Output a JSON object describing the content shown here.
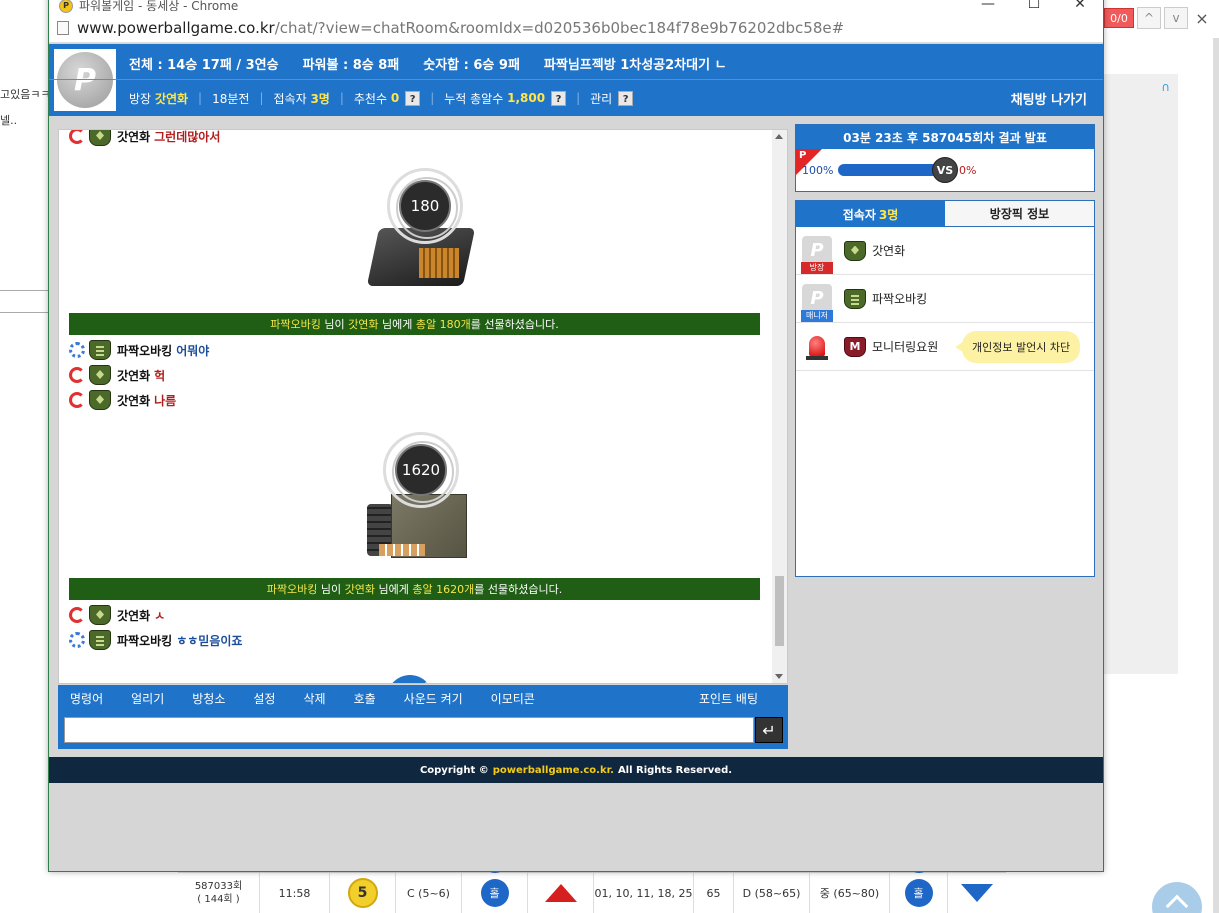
{
  "background": {
    "left_texts": [
      "고있음ㅋㅋ",
      "넬.."
    ],
    "find": {
      "count": "0/0",
      "up": "^",
      "down": "v",
      "close": "×"
    },
    "row": {
      "round": "587033회",
      "round_sub": "( 144회 )",
      "time": "11:58",
      "ball": "5",
      "range": "C (5~6)",
      "oddeven": "홀",
      "numbers": "01, 10, 11, 18, 25",
      "sum": "65",
      "sum_range": "D (58~65)",
      "size": "중 (65~80)",
      "oddeven2": "홀"
    }
  },
  "window": {
    "title": "파워볼게임 - 동세상 - Chrome",
    "url_host": "www.powerballgame.co.kr",
    "url_path": "/chat/?view=chatRoom&roomIdx=d020536b0bec184f78e9b76202dbc58e#",
    "controls": {
      "minimize": "—",
      "maximize": "☐",
      "close": "✕"
    }
  },
  "header": {
    "logo_letter": "P",
    "stats": {
      "total": "전체 : 14승 17패 / 3연승",
      "powerball": "파워볼 : 8승 8패",
      "numbersum": "숫자합 : 6승 9패",
      "room_name": "파짝님프젝방 1차성공2차대기 ㄴ"
    },
    "sub": {
      "owner_label": "방장",
      "owner_name": "갓연화",
      "rank": "18분전",
      "users_label": "접속자",
      "users_value": "3명",
      "recommend_label": "추천수",
      "recommend_value": "0",
      "total_label": "누적 총알수",
      "total_value": "1,800",
      "manage_label": "관리",
      "help": "?",
      "exit": "채팅방 나가기"
    }
  },
  "chat": {
    "messages": [
      {
        "nick": "갓연화",
        "text": "그런데많아서"
      },
      {
        "nick": "파짝오바킹",
        "text": "어뭐야"
      },
      {
        "nick": "갓연화",
        "text": "헉"
      },
      {
        "nick": "갓연화",
        "text": "나름"
      },
      {
        "nick": "갓연화",
        "text": "ㅅ"
      },
      {
        "nick": "파짝오바킹",
        "text": "ㅎㅎ믿음이죠"
      }
    ],
    "gifts": [
      {
        "amount": "180",
        "notice": {
          "sender": "파짝오바킹",
          "mid1": " 님이 ",
          "receiver": "갓연화",
          "mid2": " 님에게 ",
          "item": "총알 180개",
          "tail": "를 선물하셨습니다."
        }
      },
      {
        "amount": "1620",
        "notice": {
          "sender": "파짝오바킹",
          "mid1": " 님이 ",
          "receiver": "갓연화",
          "mid2": " 님에게 ",
          "item": "총알 1620개",
          "tail": "를 선물하셨습니다."
        }
      }
    ],
    "commands": [
      "명령어",
      "얼리기",
      "방청소",
      "설정",
      "삭제",
      "호출",
      "사운드 켜기",
      "이모티콘"
    ],
    "point_bet": "포인트 배팅",
    "input_value": "",
    "send_icon": "↵"
  },
  "result": {
    "title": "03분 23초 후 587045회차 결과 발표",
    "flag_letter": "P",
    "left_pct": "100%",
    "vs": "VS",
    "right_pct": "0%",
    "left_progress": 1.0
  },
  "users": {
    "tab_users_label": "접속자",
    "tab_users_count": "3명",
    "tab_info": "방장픽 정보",
    "list": [
      {
        "name": "갓연화",
        "role": "방장",
        "avatar": "P"
      },
      {
        "name": "파짝오바킹",
        "role": "매니저",
        "avatar": "P"
      },
      {
        "name": "모니터링요원",
        "role": "",
        "avatar": "",
        "rank_letter": "M"
      }
    ],
    "tooltip": "개인정보 발언시 차단"
  },
  "footer": {
    "prefix": "Copyright ©",
    "site": "powerballgame.co.kr.",
    "suffix": "All Rights Reserved."
  },
  "colors": {
    "brand_blue": "#1f73c9",
    "notice_green": "#1f5e14",
    "footer_navy": "#10283f",
    "highlight_yellow": "#ffe64a",
    "red": "#d62020"
  }
}
